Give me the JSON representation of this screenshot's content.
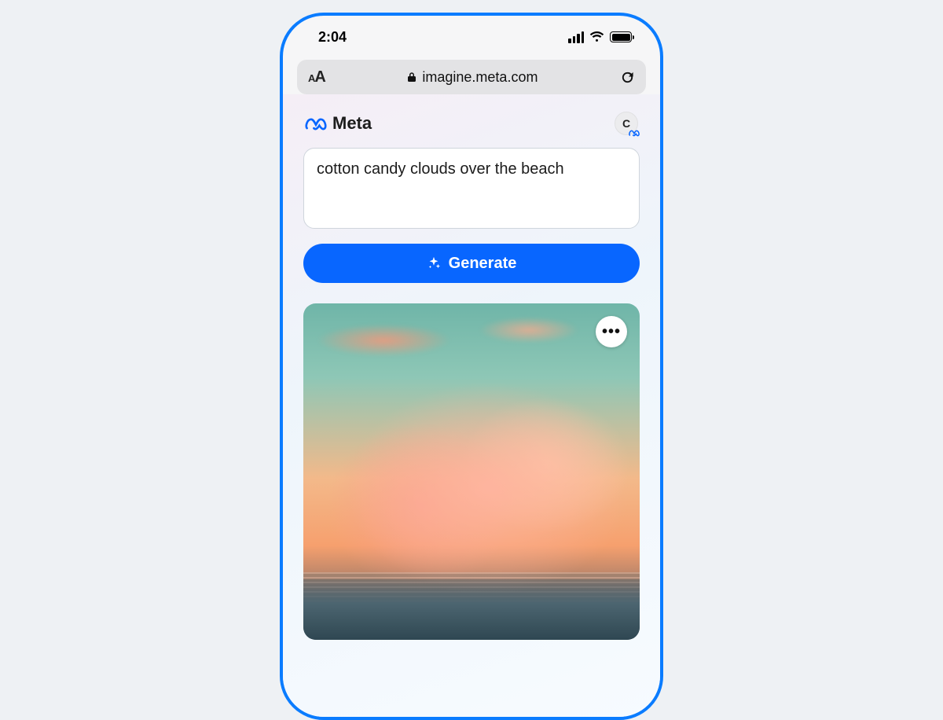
{
  "statusbar": {
    "time": "2:04"
  },
  "browser": {
    "url": "imagine.meta.com"
  },
  "brand": {
    "name": "Meta",
    "accent": "#0866ff"
  },
  "avatar": {
    "initial": "C"
  },
  "prompt": {
    "value": "cotton candy clouds over the beach"
  },
  "buttons": {
    "generate": "Generate"
  },
  "image": {
    "alt": "cotton candy clouds over the beach"
  }
}
